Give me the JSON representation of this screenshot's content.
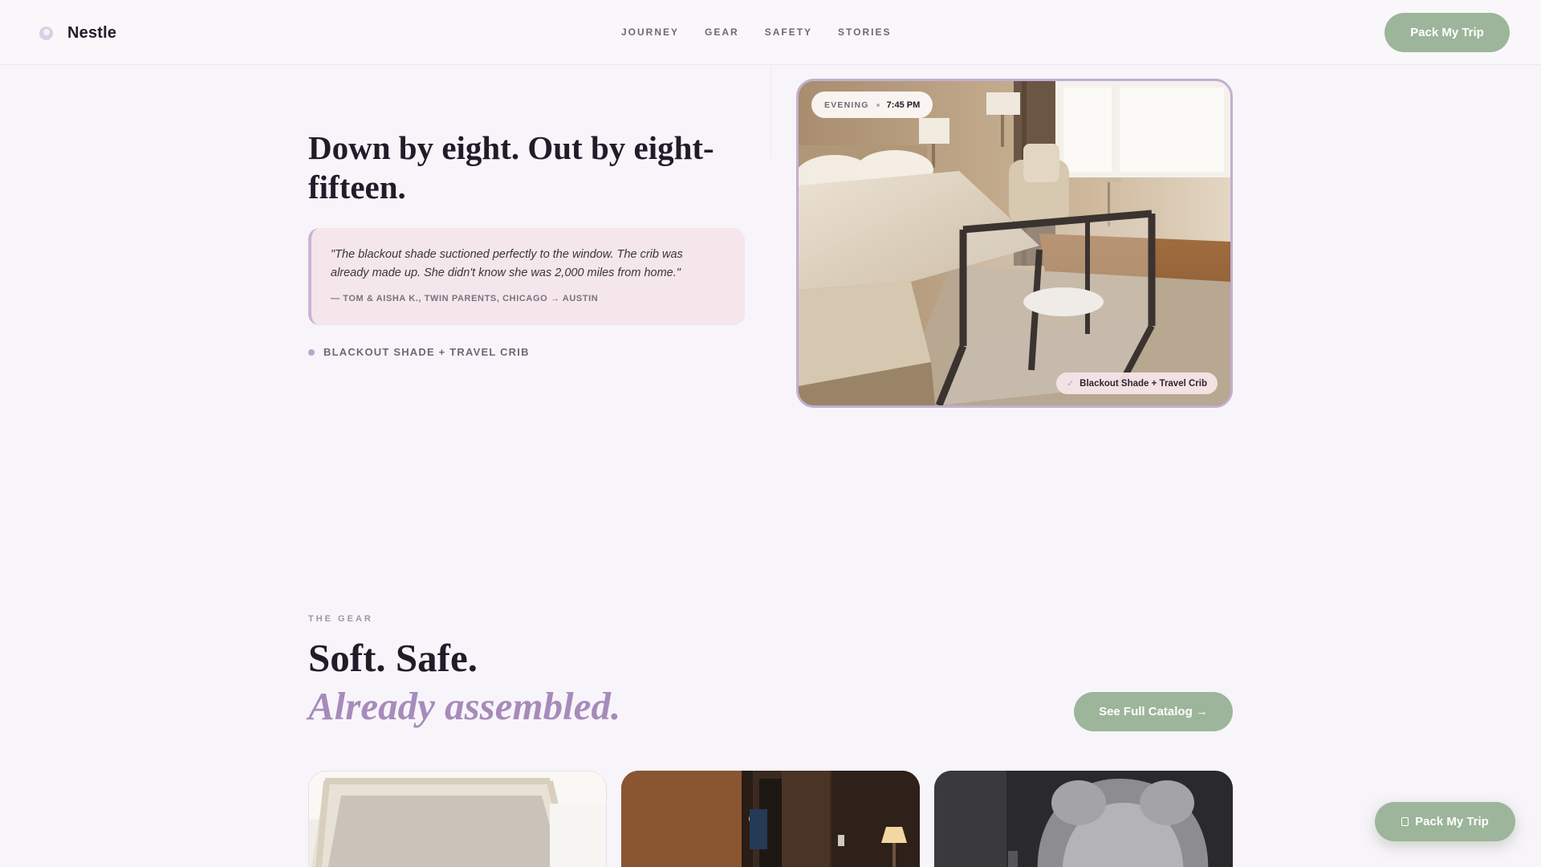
{
  "header": {
    "brand": "Nestle",
    "nav": [
      "JOURNEY",
      "GEAR",
      "SAFETY",
      "STORIES"
    ],
    "cta_label": "Pack My Trip"
  },
  "hero": {
    "title": "Down by eight. Out by eight-fifteen.",
    "quote": "\"The blackout shade suctioned perfectly to the window. The crib was already made up. She didn't know she was 2,000 miles from home.\"",
    "attribution": "— TOM & AISHA K., TWIN PARENTS, CHICAGO → AUSTIN",
    "product_tag": "BLACKOUT SHADE + TRAVEL CRIB",
    "photo": {
      "time_label": "EVENING",
      "time_value": "7:45 PM",
      "badge_check": "✓",
      "badge_text": "Blackout Shade + Travel Crib"
    }
  },
  "gear": {
    "eyebrow": "THE GEAR",
    "title": "Soft. Safe.",
    "subtitle": "Already assembled.",
    "catalog_label": "See Full Catalog →"
  },
  "floating_cta": {
    "label": "Pack My Trip",
    "icon": "bag-icon"
  },
  "colors": {
    "background": "#f8f5fa",
    "sage": "#9db59b",
    "lavender": "#a78bbb",
    "blush": "#f4e6ea",
    "ink": "#221c2a"
  }
}
